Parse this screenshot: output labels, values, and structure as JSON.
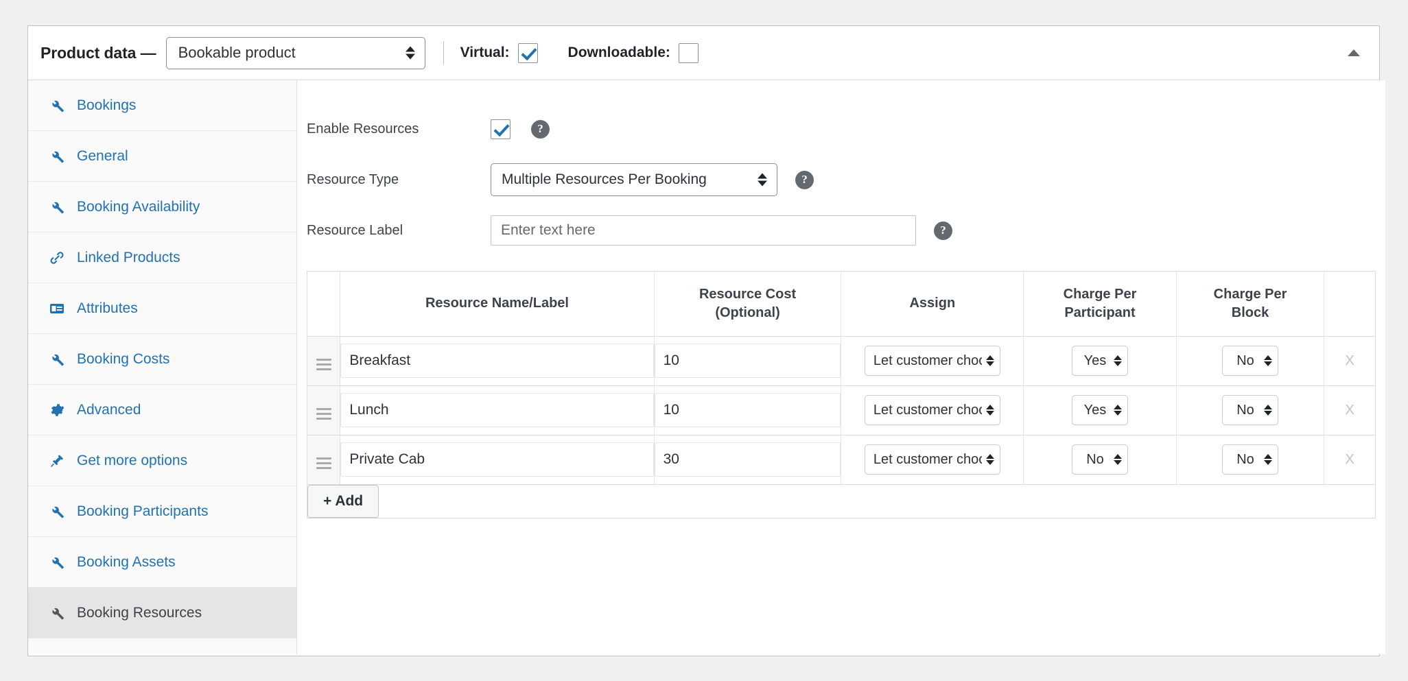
{
  "header": {
    "title": "Product data —",
    "product_type": "Bookable product",
    "virtual_label": "Virtual:",
    "virtual_checked": true,
    "downloadable_label": "Downloadable:",
    "downloadable_checked": false,
    "collapse_icon": "chevron-up-icon"
  },
  "sidebar": {
    "items": [
      {
        "label": "Bookings",
        "icon": "wrench-icon",
        "active": false
      },
      {
        "label": "General",
        "icon": "wrench-icon",
        "active": false
      },
      {
        "label": "Booking Availability",
        "icon": "wrench-icon",
        "active": false
      },
      {
        "label": "Linked Products",
        "icon": "link-icon",
        "active": false
      },
      {
        "label": "Attributes",
        "icon": "attributes-icon",
        "active": false
      },
      {
        "label": "Booking Costs",
        "icon": "wrench-icon",
        "active": false
      },
      {
        "label": "Advanced",
        "icon": "gear-icon",
        "active": false
      },
      {
        "label": "Get more options",
        "icon": "plug-icon",
        "active": false
      },
      {
        "label": "Booking Participants",
        "icon": "wrench-icon",
        "active": false
      },
      {
        "label": "Booking Assets",
        "icon": "wrench-icon",
        "active": false
      },
      {
        "label": "Booking Resources",
        "icon": "wrench-icon",
        "active": true
      }
    ]
  },
  "form": {
    "enable_resources_label": "Enable Resources",
    "enable_resources_checked": true,
    "resource_type_label": "Resource Type",
    "resource_type_value": "Multiple Resources Per Booking",
    "resource_label_label": "Resource Label",
    "resource_label_value": "",
    "resource_label_placeholder": "Enter text here",
    "help_glyph": "?"
  },
  "table": {
    "headers": {
      "handle": "",
      "name": "Resource Name/Label",
      "cost": "Resource Cost\n(Optional)",
      "cost_line1": "Resource Cost",
      "cost_line2": "(Optional)",
      "assign": "Assign",
      "participant_line1": "Charge Per",
      "participant_line2": "Participant",
      "block_line1": "Charge Per",
      "block_line2": "Block",
      "delete": ""
    },
    "rows": [
      {
        "name": "Breakfast",
        "cost": "10",
        "assign": "Let customer choose",
        "charge_per_participant": "Yes",
        "charge_per_block": "No",
        "delete_label": "X"
      },
      {
        "name": "Lunch",
        "cost": "10",
        "assign": "Let customer choose",
        "charge_per_participant": "Yes",
        "charge_per_block": "No",
        "delete_label": "X"
      },
      {
        "name": "Private Cab",
        "cost": "30",
        "assign": "Let customer choose",
        "charge_per_participant": "No",
        "charge_per_block": "No",
        "delete_label": "X"
      }
    ],
    "add_button": "+ Add"
  },
  "colors": {
    "link": "#2271b1",
    "accent_check": "#2271b1",
    "panel_bg": "#ffffff",
    "page_bg": "#f0f0f1",
    "sidebar_bg": "#fafafa",
    "sidebar_active_bg": "#e5e5e5",
    "border": "#dcdcde"
  }
}
